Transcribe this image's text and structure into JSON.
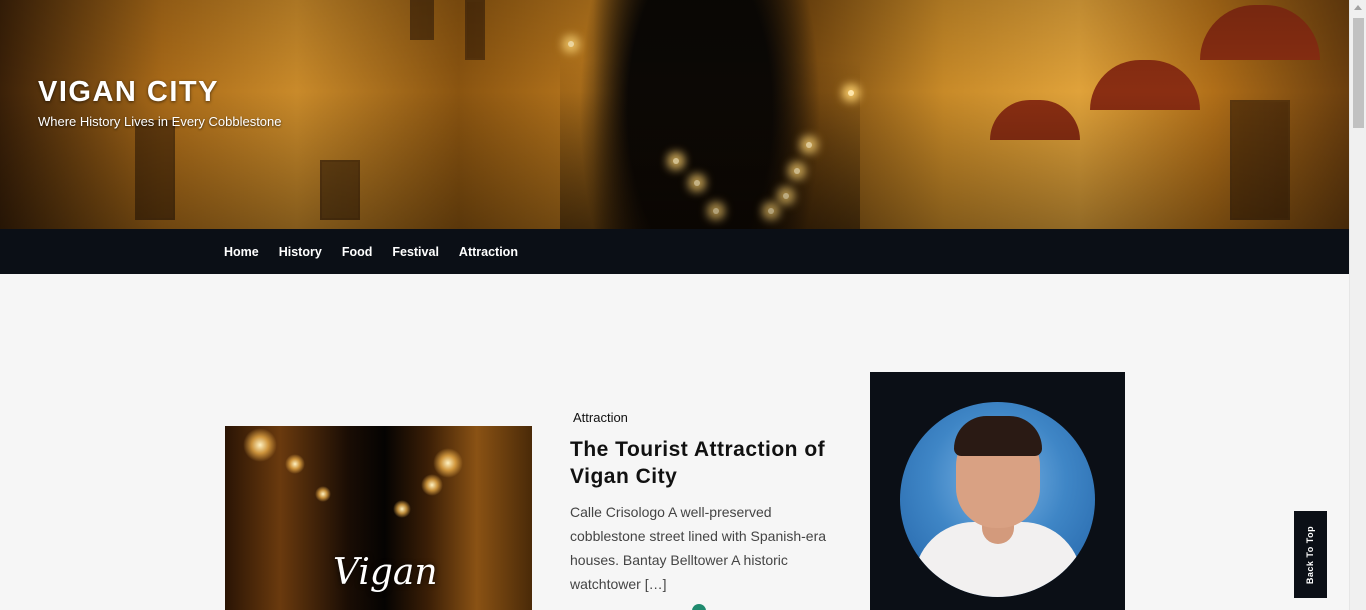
{
  "site": {
    "title": "VIGAN CITY",
    "tagline": "Where History Lives in Every Cobblestone"
  },
  "nav": {
    "items": [
      "Home",
      "History",
      "Food",
      "Festival",
      "Attraction"
    ]
  },
  "post": {
    "category": "Attraction",
    "title": "The Tourist Attraction of Vigan City",
    "excerpt": "Calle Crisologo A well-preserved cobblestone street lined with Spanish-era houses. Bantay Belltower A historic watchtower […]",
    "thumbnail_text": "Vigan"
  },
  "back_to_top": {
    "label": "Back To Top"
  },
  "colors": {
    "nav_bg": "#0b0f16",
    "page_bg": "#f6f6f6",
    "accent": "#1f8a6e"
  }
}
